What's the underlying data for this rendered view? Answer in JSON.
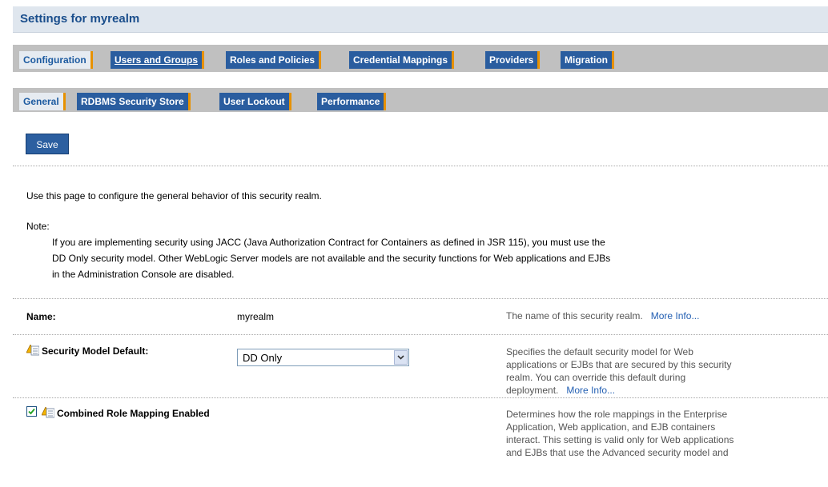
{
  "header": {
    "title": "Settings for myrealm"
  },
  "tabs_main": [
    {
      "label": "Configuration"
    },
    {
      "label": "Users and Groups"
    },
    {
      "label": "Roles and Policies"
    },
    {
      "label": "Credential Mappings"
    },
    {
      "label": "Providers"
    },
    {
      "label": "Migration"
    }
  ],
  "tabs_sub": [
    {
      "label": "General"
    },
    {
      "label": "RDBMS Security Store"
    },
    {
      "label": "User Lockout"
    },
    {
      "label": "Performance"
    }
  ],
  "toolbar": {
    "save_label": "Save"
  },
  "intro": {
    "description": "Use this page to configure the general behavior of this security realm.",
    "note_label": "Note:",
    "note_lines": [
      "If you are implementing security using JACC (Java Authorization Contract for Containers as defined in JSR 115), you must use the",
      "DD Only security model. Other WebLogic Server models are not available and the security functions for Web applications and EJBs",
      "in the Administration Console are disabled."
    ]
  },
  "fields": {
    "name": {
      "label": "Name:",
      "value": "myrealm",
      "help": "The name of this security realm.",
      "more": "More Info..."
    },
    "security_model": {
      "label": "Security Model Default:",
      "selected": "DD Only",
      "help_lines": [
        "Specifies the default security model for Web",
        "applications or EJBs that are secured by this security",
        "realm. You can override this default during",
        "deployment."
      ],
      "more": "More Info..."
    },
    "combined_role": {
      "label": "Combined Role Mapping Enabled",
      "checked": true,
      "help_lines": [
        "Determines how the role mappings in the Enterprise",
        "Application, Web application, and EJB containers",
        "interact. This setting is valid only for Web applications",
        "and EJBs that use the Advanced security model and"
      ]
    }
  },
  "colors": {
    "accent": "#2a5d9f",
    "tab_divider": "#e79100",
    "link": "#2460b3"
  }
}
